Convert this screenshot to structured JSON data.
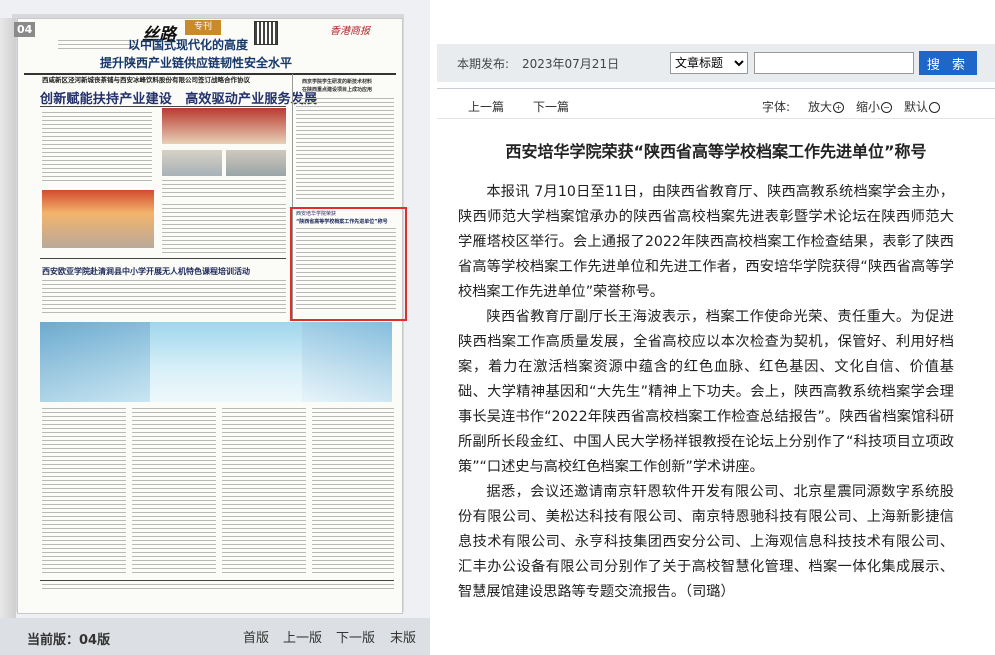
{
  "newspaper": {
    "page_badge": "04",
    "brand_silu": "丝路",
    "brand_zhuankan": "专刊",
    "paper_logo": "香港商报",
    "headlines": {
      "top_small": "西咸新区泾河新城丧茶铺与西安冰峰饮料股份有限公司签订战略合作协议",
      "top_big": "创新赋能扶持产业建设　高效驱动产业服务发展",
      "right_small1": "西京学院学生研发的新技术材料",
      "right_small2": "在陕西重点建设项目上成功应用",
      "mid": "西安欧亚学院赴清涧县中小学开展无人机特色课程培训活动",
      "banner_line1": "以中国式现代化的高度",
      "banner_line2": "提升陕西产业链供应链韧性安全水平",
      "box_title1": "西安培华学院荣获",
      "box_title2": "“陕西省高等学校档案工作先进单位”称号"
    }
  },
  "pager": {
    "current_edition": "当前版：04版",
    "first": "首版",
    "prev": "上一版",
    "next": "下一版",
    "last": "末版"
  },
  "search": {
    "issue_label": "本期发布:",
    "issue_date": "2023年07月21日",
    "select_value": "文章标题",
    "input_value": "",
    "button_label": "搜 索"
  },
  "toolbar": {
    "prev_article": "上一篇",
    "next_article": "下一篇",
    "font_label": "字体:",
    "zoom_in": "放大",
    "zoom_out": "缩小",
    "zoom_default": "默认"
  },
  "article": {
    "title": "西安培华学院荣获“陕西省高等学校档案工作先进单位”称号",
    "paragraphs": [
      "本报讯  7月10日至11日，由陕西省教育厅、陕西高教系统档案学会主办，陕西师范大学档案馆承办的陕西省高校档案先进表彰暨学术论坛在陕西师范大学雁塔校区举行。会上通报了2022年陕西高校档案工作检查结果，表彰了陕西省高等学校档案工作先进单位和先进工作者，西安培华学院获得“陕西省高等学校档案工作先进单位”荣誉称号。",
      "陕西省教育厅副厅长王海波表示，档案工作使命光荣、责任重大。为促进陕西档案工作高质量发展，全省高校应以本次检查为契机，保管好、利用好档案，着力在激活档案资源中蕴含的红色血脉、红色基因、文化自信、价值基础、大学精神基因和“大先生”精神上下功夫。会上，陕西高教系统档案学会理事长吴连书作“2022年陕西省高校档案工作检查总结报告”。陕西省档案馆科研所副所长段金红、中国人民大学杨祥银教授在论坛上分别作了“科技项目立项政策”“口述史与高校红色档案工作创新”学术讲座。",
      "据悉，会议还邀请南京轩恩软件开发有限公司、北京星震同源数字系统股份有限公司、美松达科技有限公司、南京特恩驰科技有限公司、上海新影捷信息技术有限公司、永亨科技集团西安分公司、上海观信息科技技术有限公司、汇丰办公设备有限公司分别作了关于高校智慧化管理、档案一体化集成展示、智慧展馆建设思路等专题交流报告。（司璐）"
    ]
  }
}
